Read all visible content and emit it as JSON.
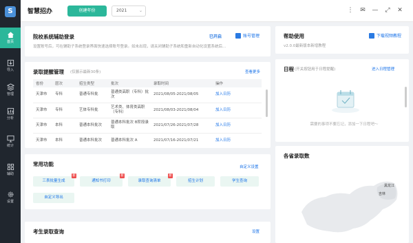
{
  "sidebar": {
    "logo": "S",
    "items": [
      {
        "label": "首页",
        "icon": "home-icon"
      },
      {
        "label": "导入",
        "icon": "import-icon"
      },
      {
        "label": "管理",
        "icon": "layers-icon"
      },
      {
        "label": "分析",
        "icon": "chart-icon"
      },
      {
        "label": "统计",
        "icon": "monitor-icon"
      },
      {
        "label": "辅助",
        "icon": "grid-icon"
      },
      {
        "label": "设置",
        "icon": "gear-icon"
      }
    ]
  },
  "topbar": {
    "title": "智慧招办",
    "create_button": "创建年份",
    "year": "2021"
  },
  "login_card": {
    "title": "院校系统辅助登录",
    "status": "已开启",
    "account_button": "账号管理",
    "desc": "设置账号后，可在辅助子系统登录界面快速选择账号登录。如未出现，请关闭辅助子系统和重新自动化设置系统后..."
  },
  "admission_card": {
    "title": "录取提醒管理",
    "subtitle": "(仅展示最新30条)",
    "more": "查看更多",
    "columns": [
      "省份",
      "层次",
      "招生类型",
      "批次",
      "录取时间",
      "操作"
    ],
    "rows": [
      {
        "province": "天津市",
        "level": "专科",
        "type": "普通专科批",
        "batch": "普通类高职（专科）批次",
        "time": "2021/08/05-2021/08/05",
        "action": "加入日历"
      },
      {
        "province": "天津市",
        "level": "专科",
        "type": "艺体专科批",
        "batch": "艺术类、体育类高职（专科）",
        "time": "2021/08/03-2021/08/04",
        "action": "加入日历"
      },
      {
        "province": "天津市",
        "level": "本科",
        "type": "普通本科批次",
        "batch": "普通本科批次 B阶段录取",
        "time": "2021/07/26-2021/07/28",
        "action": "加入日历"
      },
      {
        "province": "天津市",
        "level": "本科",
        "type": "普通本科批次",
        "batch": "普通本科批次 A",
        "time": "2021/07/16-2021/07/21",
        "action": "加入日历"
      }
    ]
  },
  "common_card": {
    "title": "常用功能",
    "custom_link": "自定义设置",
    "buttons": [
      "三表批量生成",
      "通知书打印",
      "录取查询清单",
      "招生计划",
      "学生查询",
      "自定义导出"
    ],
    "badge": "新"
  },
  "student_card": {
    "title": "考生录取查询",
    "link": "设置"
  },
  "help_card": {
    "title": "帮助使用",
    "subtitle": "v2.0.0最新版本新增教程",
    "link": "下载视频教程"
  },
  "schedule_card": {
    "title": "日程",
    "subtitle": "(开关按钮用于日程提醒)",
    "link": "进入日程管理",
    "empty": "需要的事项不要忘记，添加一下日程吧～"
  },
  "province_card": {
    "title": "各省录取数",
    "map_labels": [
      "黑龙江",
      "吉林"
    ]
  },
  "colors": {
    "accent": "#2bb79a",
    "sidebar": "#20262e",
    "link": "#1a73e8"
  }
}
